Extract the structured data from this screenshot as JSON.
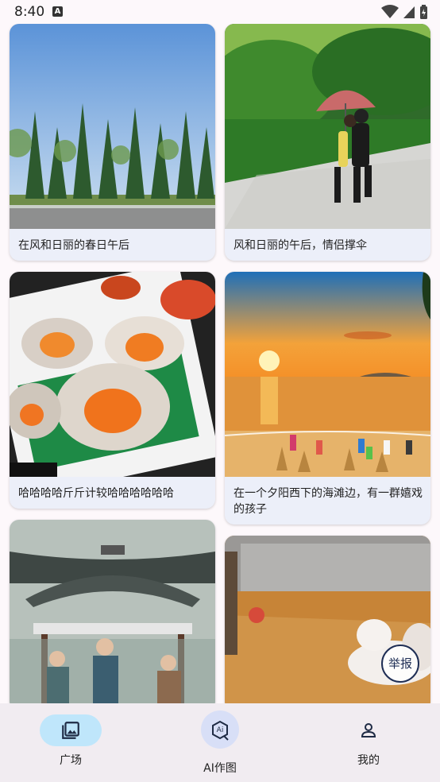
{
  "status_bar": {
    "time": "8:40",
    "notification_icon_text": "A"
  },
  "feed": {
    "cards": [
      {
        "caption": "在风和日丽的春日午后"
      },
      {
        "caption": "风和日丽的午后，情侣撑伞"
      },
      {
        "caption": "哈哈哈哈斤斤计较哈哈哈哈哈哈"
      },
      {
        "caption": "在一个夕阳西下的海滩边，有一群嬉戏的孩子"
      }
    ]
  },
  "report_button": {
    "label": "举报"
  },
  "bottom_nav": {
    "items": [
      {
        "label": "广场",
        "icon": "gallery-icon",
        "selected": true
      },
      {
        "label": "AI作图",
        "icon": "ai-draw-icon",
        "selected": false
      },
      {
        "label": "我的",
        "icon": "person-icon",
        "selected": false
      }
    ]
  },
  "colors": {
    "nav_selected_pill": "#bfe6fb",
    "ai_circle": "#d8dff7",
    "card_bg": "#eceff9"
  }
}
